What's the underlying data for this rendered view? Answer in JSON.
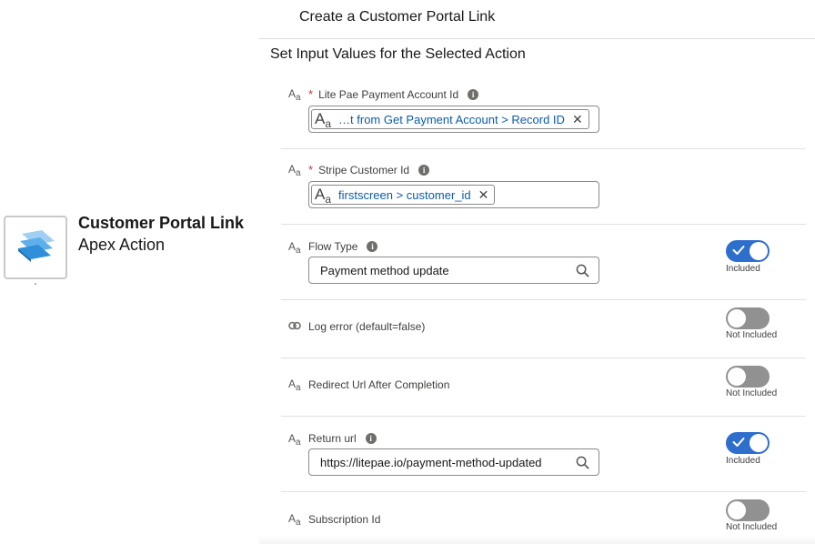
{
  "node": {
    "title": "Customer Portal Link",
    "subtitle": "Apex Action",
    "icon": "apex-action-layers-icon",
    "icon_color": "#4a9fdd"
  },
  "panel": {
    "title": "Create a Customer Portal Link",
    "section_title": "Set Input Values for the Selected Action"
  },
  "fields": {
    "account_id": {
      "type_icon": "text-type-icon",
      "label": "Lite Pae Payment Account Id",
      "required_mark": "*",
      "info": "i",
      "pill_text": "…t from Get Payment Account > Record ID",
      "pill_close": "✕"
    },
    "customer_id": {
      "type_icon": "text-type-icon",
      "label": "Stripe Customer Id",
      "required_mark": "*",
      "info": "i",
      "pill_text": "firstscreen > customer_id",
      "pill_close": "✕"
    },
    "flow_type": {
      "type_icon": "text-type-icon",
      "label": "Flow Type",
      "info": "i",
      "value": "Payment method update",
      "toggle_label": "Included",
      "toggle_on": true
    },
    "log_error": {
      "type_icon": "boolean-link-icon",
      "label": "Log error (default=false)",
      "toggle_label": "Not Included",
      "toggle_on": false
    },
    "redirect_url": {
      "type_icon": "text-type-icon",
      "label": "Redirect Url After Completion",
      "toggle_label": "Not Included",
      "toggle_on": false
    },
    "return_url": {
      "type_icon": "text-type-icon",
      "label": "Return url",
      "info": "i",
      "value": "https://litepae.io/payment-method-updated",
      "toggle_label": "Included",
      "toggle_on": true
    },
    "subscription_id": {
      "type_icon": "text-type-icon",
      "label": "Subscription Id",
      "toggle_label": "Not Included",
      "toggle_on": false
    }
  },
  "type_icon_glyphs": {
    "big": "A",
    "small": "a"
  },
  "colors": {
    "toggle_on": "#2e6ecc",
    "toggle_off": "#919191",
    "required": "#c23934",
    "pill_text": "#0b5cab"
  }
}
